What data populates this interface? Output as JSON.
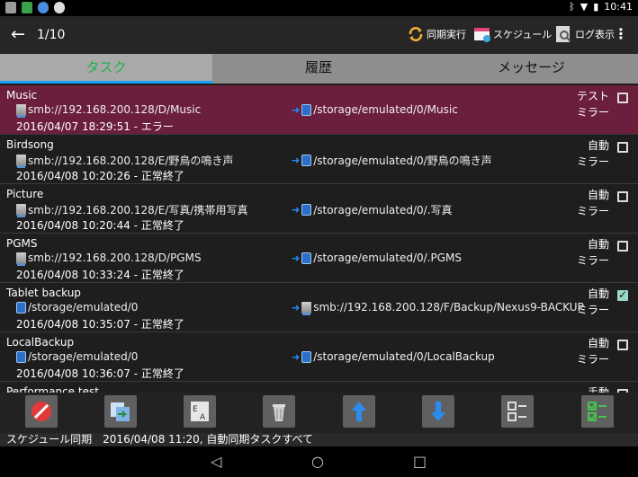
{
  "status_bar": {
    "time": "10:41"
  },
  "action_bar": {
    "position": "1/10",
    "sync_label": "同期実行",
    "schedule_label": "スケジュール",
    "log_label": "ログ表示"
  },
  "tabs": [
    {
      "label": "タスク"
    },
    {
      "label": "履歴"
    },
    {
      "label": "メッセージ"
    }
  ],
  "tasks": [
    {
      "name": "Music",
      "source": "smb://192.168.200.128/D/Music",
      "dest": "/storage/emulated/0/Music",
      "time": "2016/04/07 18:29:51 - エラー",
      "schedule": "テスト",
      "mode": "ミラー",
      "checked": false
    },
    {
      "name": "Birdsong",
      "source": "smb://192.168.200.128/E/野鳥の鳴き声",
      "dest": "/storage/emulated/0/野鳥の鳴き声",
      "time": "2016/04/08 10:20:26 - 正常終了",
      "schedule": "自動",
      "mode": "ミラー",
      "checked": false
    },
    {
      "name": "Picture",
      "source": "smb://192.168.200.128/E/写真/携帯用写真",
      "dest": "/storage/emulated/0/.写真",
      "time": "2016/04/08 10:20:44 - 正常終了",
      "schedule": "自動",
      "mode": "ミラー",
      "checked": false
    },
    {
      "name": "PGMS",
      "source": "smb://192.168.200.128/D/PGMS",
      "dest": "/storage/emulated/0/.PGMS",
      "time": "2016/04/08 10:33:24 - 正常終了",
      "schedule": "自動",
      "mode": "ミラー",
      "checked": false
    },
    {
      "name": "Tablet backup",
      "source": "/storage/emulated/0",
      "dest": "smb://192.168.200.128/F/Backup/Nexus9-BACKUP",
      "time": "2016/04/08 10:35:07 - 正常終了",
      "schedule": "自動",
      "mode": "ミラー",
      "checked": true
    },
    {
      "name": "LocalBackup",
      "source": "/storage/emulated/0",
      "dest": "/storage/emulated/0/LocalBackup",
      "time": "2016/04/08 10:36:07 - 正常終了",
      "schedule": "自動",
      "mode": "ミラー",
      "checked": false
    },
    {
      "name": "Performance test",
      "source": "",
      "dest": "",
      "time": "",
      "schedule": "手動",
      "mode": "",
      "checked": false
    }
  ],
  "toolbar_icons": [
    "cancel-icon",
    "copy-icon",
    "export-icon",
    "delete-icon",
    "move-up-icon",
    "move-down-icon",
    "unselect-all-icon",
    "select-all-icon"
  ],
  "schedule_status": "スケジュール同期　2016/04/08 11:20, 自動同期タスクすべて",
  "colors": {
    "selected_row": "#6b1f3d",
    "active_tab_text": "#1db34a",
    "tab_indicator": "#1aa0ff"
  }
}
